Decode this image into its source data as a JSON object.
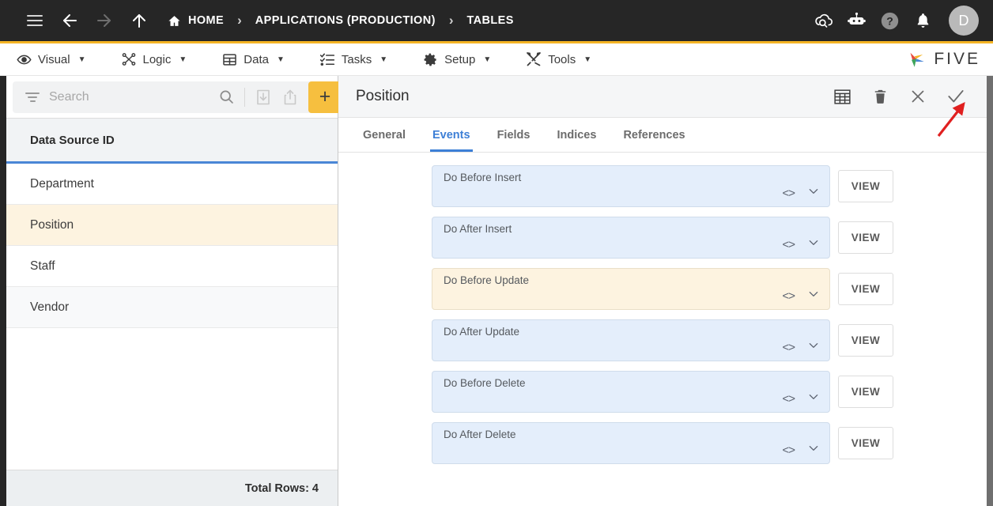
{
  "topbar": {
    "menu_icon": "hamburger-icon",
    "back_icon": "arrow-left-icon",
    "forward_icon": "arrow-right-icon",
    "up_icon": "arrow-up-icon",
    "breadcrumbs": [
      {
        "label": "HOME",
        "icon": "home-icon"
      },
      {
        "label": "APPLICATIONS (PRODUCTION)",
        "icon": ""
      },
      {
        "label": "TABLES",
        "icon": ""
      }
    ],
    "separator": "›",
    "right_icons": [
      {
        "name": "cloud-search-icon"
      },
      {
        "name": "robot-icon"
      },
      {
        "name": "help-icon"
      },
      {
        "name": "bell-icon"
      }
    ],
    "avatar_initial": "D"
  },
  "menubar": {
    "items": [
      {
        "label": "Visual",
        "icon": "eye-icon"
      },
      {
        "label": "Logic",
        "icon": "nodes-icon"
      },
      {
        "label": "Data",
        "icon": "table-icon"
      },
      {
        "label": "Tasks",
        "icon": "checklist-icon"
      },
      {
        "label": "Setup",
        "icon": "gear-icon"
      },
      {
        "label": "Tools",
        "icon": "tools-icon"
      }
    ],
    "caret": "▼",
    "brand": "FIVE"
  },
  "sidebar": {
    "search": {
      "value": "",
      "placeholder": "Search"
    },
    "search_icon": "search-icon",
    "filter_icon": "filter-icon",
    "import_icon": "import-icon",
    "export_icon": "export-icon",
    "add_label": "+",
    "grid": {
      "column_header": "Data Source ID",
      "rows": [
        {
          "label": "Department",
          "selected": false
        },
        {
          "label": "Position",
          "selected": true
        },
        {
          "label": "Staff",
          "selected": false
        },
        {
          "label": "Vendor",
          "selected": false
        }
      ],
      "footer": "Total Rows: 4"
    }
  },
  "detail": {
    "title": "Position",
    "actions": [
      {
        "name": "grid-view-icon"
      },
      {
        "name": "delete-icon"
      },
      {
        "name": "close-icon"
      },
      {
        "name": "save-check-icon"
      }
    ],
    "tabs": [
      {
        "label": "General",
        "active": false
      },
      {
        "label": "Events",
        "active": true
      },
      {
        "label": "Fields",
        "active": false
      },
      {
        "label": "Indices",
        "active": false
      },
      {
        "label": "References",
        "active": false
      }
    ],
    "events": [
      {
        "label": "Do Before Insert",
        "value": "",
        "highlight": false,
        "view_label": "VIEW"
      },
      {
        "label": "Do After Insert",
        "value": "",
        "highlight": false,
        "view_label": "VIEW"
      },
      {
        "label": "Do Before Update",
        "value": "",
        "highlight": true,
        "view_label": "VIEW"
      },
      {
        "label": "Do After Update",
        "value": "",
        "highlight": false,
        "view_label": "VIEW"
      },
      {
        "label": "Do Before Delete",
        "value": "",
        "highlight": false,
        "view_label": "VIEW"
      },
      {
        "label": "Do After Delete",
        "value": "",
        "highlight": false,
        "view_label": "VIEW"
      }
    ],
    "event_code_icon": "code-icon",
    "event_expand_icon": "chevron-down-icon"
  },
  "annotation": {
    "arrow_color": "#e02020",
    "points_to": "save-check-icon"
  },
  "colors": {
    "accent": "#f5b425",
    "topbar_bg": "#262626",
    "tab_active": "#3d7fd6",
    "row_highlight": "#fdf3e0",
    "event_blue": "#e4eefb"
  }
}
